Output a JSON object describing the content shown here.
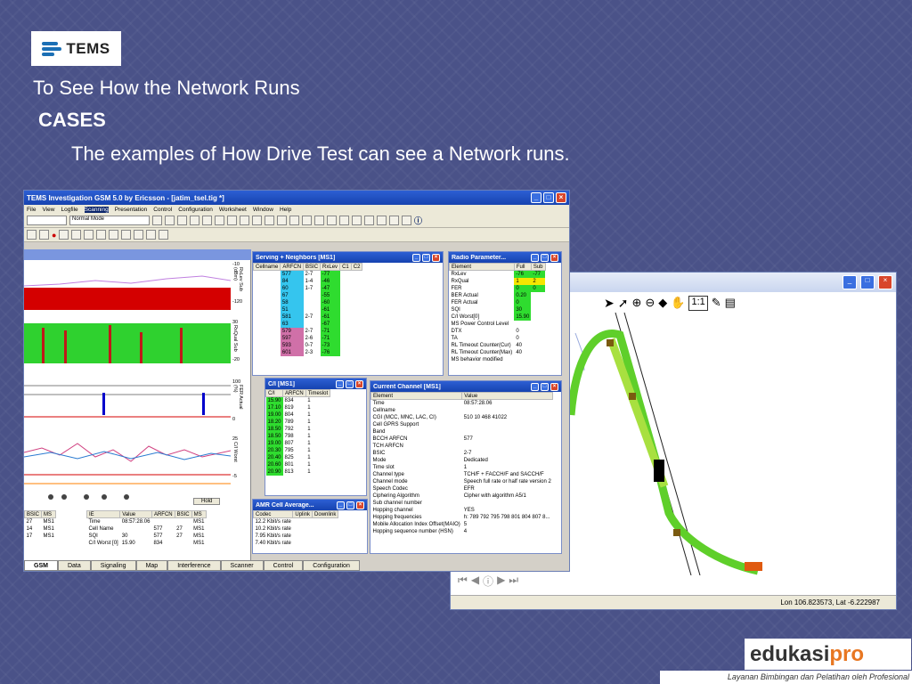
{
  "slide": {
    "logo_text": "TEMS",
    "heading": "To See How the Network Runs",
    "subheading": "CASES",
    "body": "The examples of How Drive Test can see a Network runs."
  },
  "main_window": {
    "title": "TEMS Investigation GSM 5.0  by Ericsson - [jatim_tsel.tig *]",
    "menu": [
      "File",
      "View",
      "Logfile",
      "Scanning",
      "Presentation",
      "Control",
      "Configuration",
      "Worksheet",
      "Window",
      "Help"
    ],
    "mode_select": "Normal Mode",
    "hold_label": "Hold",
    "tabs": [
      "GSM",
      "Data",
      "Signaling",
      "Map",
      "Interference",
      "Scanner",
      "Control",
      "Configuration"
    ],
    "active_tab": "GSM",
    "chart_axes": [
      {
        "label": "RxLev Sub (dBm)",
        "ticks": [
          "-10",
          "-120"
        ]
      },
      {
        "label": "RxQual Sub",
        "ticks": [
          "30",
          "-20"
        ]
      },
      {
        "label": "FER Actual (%)",
        "ticks": [
          "100",
          "0"
        ]
      },
      {
        "label": "C/I Worst",
        "ticks": [
          "25",
          "-5"
        ]
      }
    ],
    "events_table": {
      "headers": [
        "BSIC",
        "MS"
      ],
      "rows": [
        [
          "27",
          "MS1"
        ],
        [
          "14",
          "MS1"
        ],
        [
          "17",
          "MS1"
        ]
      ]
    },
    "info_table": {
      "headers": [
        "IE",
        "Value",
        "ARFCN",
        "BSIC",
        "MS"
      ],
      "rows": [
        [
          "Time",
          "08:57:28.06",
          "",
          "",
          "MS1"
        ],
        [
          "Cell Name",
          "",
          "577",
          "27",
          "MS1"
        ],
        [
          "SQI",
          "30",
          "577",
          "27",
          "MS1"
        ],
        [
          "C/I Worst [0]",
          "15.90",
          "834",
          "",
          "MS1"
        ]
      ]
    }
  },
  "serving_window": {
    "title": "Serving + Neighbors [MS1]",
    "headers": [
      "Cellname",
      "ARFCN",
      "BSIC",
      "RxLev",
      "C1",
      "C2"
    ],
    "rows": [
      [
        "",
        "577",
        "2-7",
        "-77"
      ],
      [
        "",
        "84",
        "1-4",
        "-46"
      ],
      [
        "",
        "60",
        "1-7",
        "-47"
      ],
      [
        "",
        "67",
        "",
        "-55"
      ],
      [
        "",
        "58",
        "",
        "-60"
      ],
      [
        "",
        "51",
        "",
        "-61"
      ],
      [
        "",
        "581",
        "2-7",
        "-61"
      ],
      [
        "",
        "63",
        "",
        "-67"
      ],
      [
        "",
        "579",
        "2-7",
        "-71"
      ],
      [
        "",
        "597",
        "2-6",
        "-71"
      ],
      [
        "",
        "593",
        "0-7",
        "-73"
      ],
      [
        "",
        "601",
        "2-3",
        "-76"
      ]
    ]
  },
  "radio_window": {
    "title": "Radio Parameter...",
    "headers": [
      "Element",
      "Full",
      "Sub"
    ],
    "rows": [
      [
        "RxLev",
        "-76",
        "-77"
      ],
      [
        "RxQual",
        "1",
        "2"
      ],
      [
        "FER",
        "0",
        "0"
      ],
      [
        "BER Actual",
        "0.20",
        ""
      ],
      [
        "FER Actual",
        "0",
        ""
      ],
      [
        "SQI",
        "30",
        ""
      ],
      [
        "C/I Worst[0]",
        "15.90",
        ""
      ],
      [
        "MS Power Control Level",
        "",
        ""
      ],
      [
        "DTX",
        "0",
        ""
      ],
      [
        "TA",
        "0",
        ""
      ],
      [
        "RL Timeout Counter(Cur)",
        "40",
        ""
      ],
      [
        "RL Timeout Counter(Max)",
        "40",
        ""
      ],
      [
        "MS behavior modified",
        "",
        ""
      ]
    ]
  },
  "ci_window": {
    "title": "C/I [MS1]",
    "headers": [
      "C/I",
      "ARFCN",
      "Timeslot"
    ],
    "rows": [
      [
        "15.90",
        "834",
        "1"
      ],
      [
        "17.10",
        "819",
        "1"
      ],
      [
        "19.00",
        "804",
        "1"
      ],
      [
        "18.20",
        "789",
        "1"
      ],
      [
        "18.50",
        "792",
        "1"
      ],
      [
        "18.50",
        "798",
        "1"
      ],
      [
        "19.00",
        "807",
        "1"
      ],
      [
        "20.30",
        "795",
        "1"
      ],
      [
        "20.40",
        "825",
        "1"
      ],
      [
        "20.60",
        "801",
        "1"
      ],
      [
        "20.90",
        "813",
        "1"
      ]
    ]
  },
  "channel_window": {
    "title": "Current Channel [MS1]",
    "headers": [
      "Element",
      "Value"
    ],
    "rows": [
      [
        "Time",
        "08:57:28.06"
      ],
      [
        "Cellname",
        ""
      ],
      [
        "CGI (MCC, MNC, LAC, CI)",
        "510 10 468 41022"
      ],
      [
        "Cell GPRS Support",
        ""
      ],
      [
        "Band",
        ""
      ],
      [
        "BCCH ARFCN",
        "577"
      ],
      [
        "TCH ARFCN",
        ""
      ],
      [
        "BSIC",
        "2-7"
      ],
      [
        "Mode",
        "Dedicated"
      ],
      [
        "Time slot",
        "1"
      ],
      [
        "Channel type",
        "TCH/F + FACCH/F and SACCH/F"
      ],
      [
        "Channel mode",
        "Speech full rate or half rate version 2"
      ],
      [
        "Speech Codec",
        "EFR"
      ],
      [
        "Ciphering Algorithm",
        "Cipher with algorithm A5/1"
      ],
      [
        "Sub channel number",
        ""
      ],
      [
        "Hopping channel",
        "YES"
      ],
      [
        "Hopping frequencies",
        "h: 789 792 795 798 801 804 807 8..."
      ],
      [
        "Mobile Allocation Index Offset(MAIO)",
        "5"
      ],
      [
        "Hopping sequence number (HSN)",
        "4"
      ]
    ]
  },
  "amr_window": {
    "title": "AMR Cell Average...",
    "headers": [
      "Codec",
      "Uplink",
      "Downlink"
    ],
    "rows": [
      [
        "12.2 Kbit/s rate"
      ],
      [
        "10.2 Kbit/s rate"
      ],
      [
        "7.95 Kbit/s rate"
      ],
      [
        "7.40 Kbit/s rate"
      ]
    ]
  },
  "map_window": {
    "status": "Lon 106.823573, Lat -6.222987"
  },
  "footer": {
    "brand_main": "edukasi",
    "brand_accent": "pro",
    "tagline": "Layanan Bimbingan dan Pelatihan oleh Profesional"
  }
}
